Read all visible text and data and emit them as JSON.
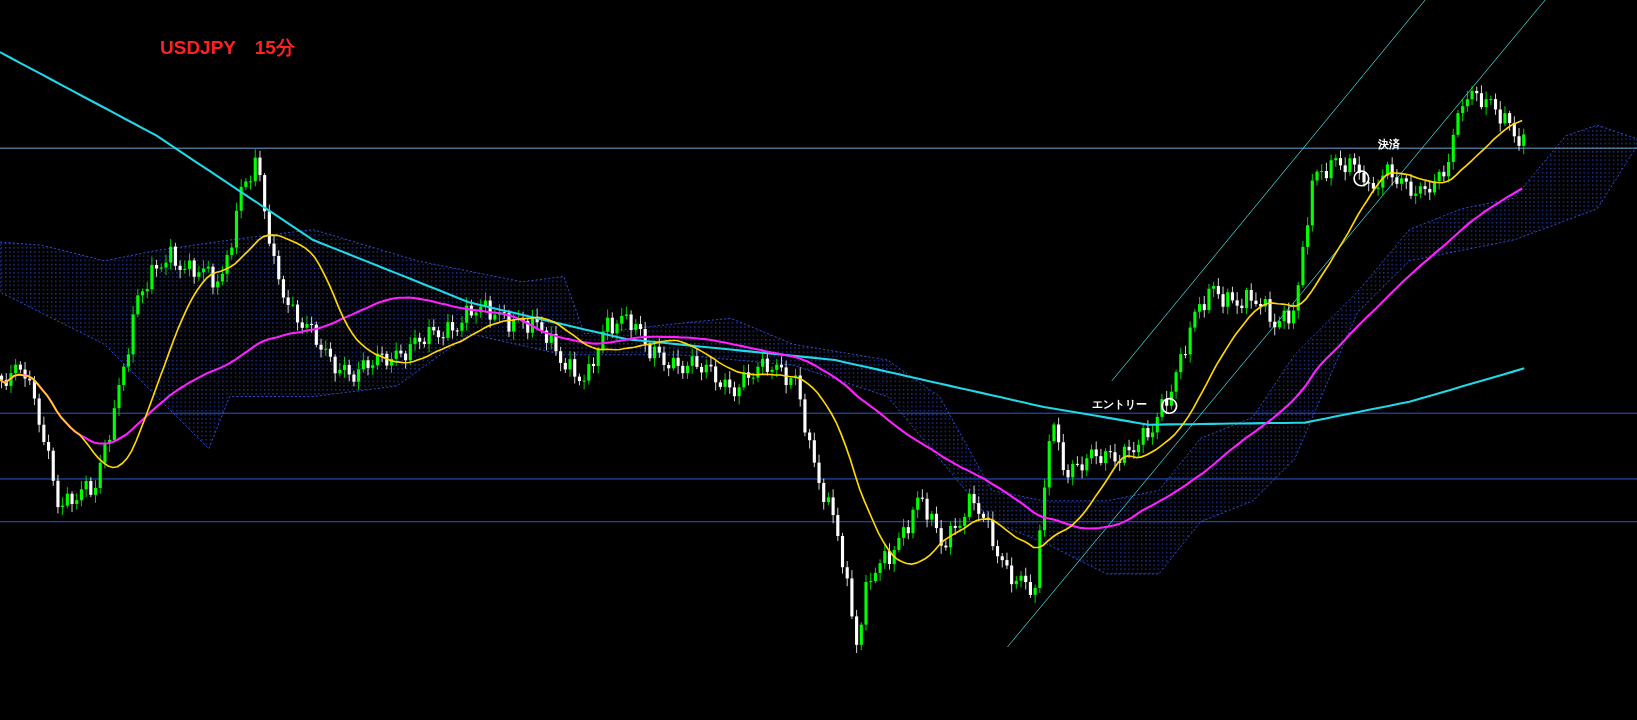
{
  "title": "USDJPY　15分",
  "annotations": [
    {
      "text": "エントリー"
    },
    {
      "text": "決済"
    }
  ]
}
